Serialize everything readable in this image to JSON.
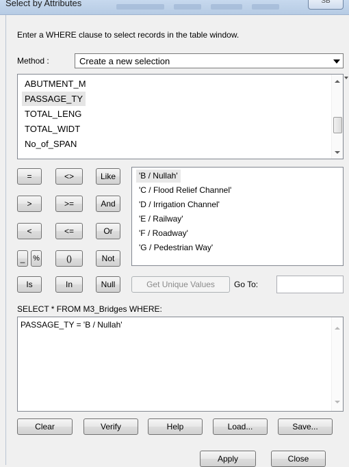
{
  "window": {
    "title": "Select by Attributes",
    "close_label": "SB"
  },
  "instructions": "Enter a WHERE clause to select records in the table window.",
  "method": {
    "label": "Method :",
    "value": "Create a new selection"
  },
  "fields": [
    "ABUTMENT_M",
    "PASSAGE_TY",
    "TOTAL_LENG",
    "TOTAL_WIDT",
    "No_of_SPAN"
  ],
  "selected_field": "PASSAGE_TY",
  "operators": {
    "eq": "=",
    "ne": "<>",
    "like": "Like",
    "gt": ">",
    "ge": ">=",
    "and": "And",
    "lt": "<",
    "le": "<=",
    "or": "Or",
    "underscore": "_",
    "percent": "%",
    "parens": "()",
    "not": "Not",
    "is": "Is",
    "in": "In",
    "null": "Null"
  },
  "values": [
    "'B / Nullah'",
    "'C / Flood Relief Channel'",
    "'D / Irrigation Channel'",
    "'E / Railway'",
    "'F / Roadway'",
    "'G / Pedestrian Way'"
  ],
  "get_unique_values_label": "Get Unique Values",
  "goto": {
    "label": "Go To:",
    "value": ""
  },
  "select_statement": "SELECT * FROM M3_Bridges WHERE:",
  "where_clause": "PASSAGE_TY = 'B / Nullah'",
  "buttons": {
    "clear": "Clear",
    "verify": "Verify",
    "help": "Help",
    "load": "Load...",
    "save": "Save...",
    "apply": "Apply",
    "close": "Close"
  },
  "colors": {
    "dialog_bg": "#f0f0f0",
    "titlebar": "#b6cbe4",
    "list_bg": "#ffffff",
    "selection_bg": "#e5e5e5",
    "button_border": "#707070"
  }
}
